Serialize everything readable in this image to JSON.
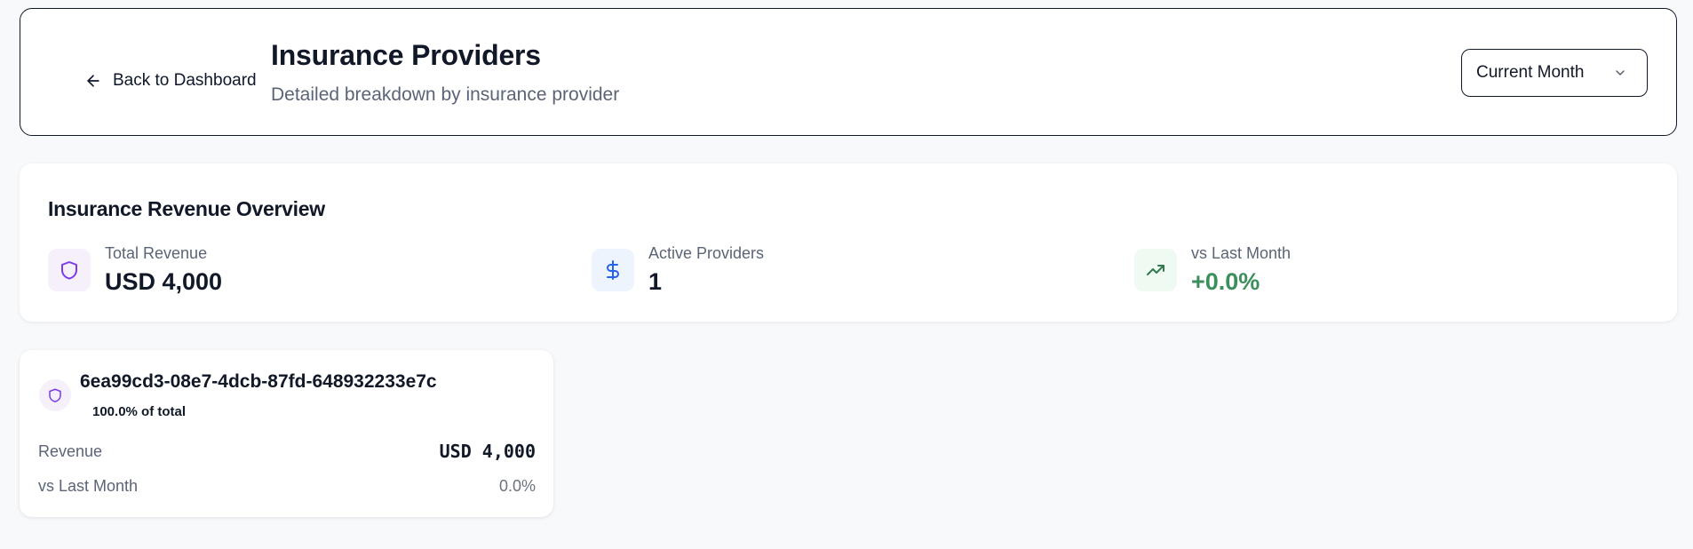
{
  "header": {
    "back_label": "Back to Dashboard",
    "title": "Insurance Providers",
    "subtitle": "Detailed breakdown by insurance provider",
    "period_select": {
      "selected": "Current Month"
    }
  },
  "overview": {
    "title": "Insurance Revenue Overview",
    "stats": [
      {
        "label": "Total Revenue",
        "value": "USD 4,000",
        "icon": "shield-icon",
        "icon_color": "#7c3aed",
        "icon_bg": "#f6f0fb"
      },
      {
        "label": "Active Providers",
        "value": "1",
        "icon": "dollar-icon",
        "icon_color": "#2563eb",
        "icon_bg": "#eef4fd"
      },
      {
        "label": "vs Last Month",
        "value": "+0.0%",
        "icon": "trending-up-icon",
        "icon_color": "#2f7a4e",
        "icon_bg": "#eefaf2",
        "value_color": "#3b8f5a"
      }
    ]
  },
  "providers": [
    {
      "name": "6ea99cd3-08e7-4dcb-87fd-648932233e7c",
      "share": "100.0% of total",
      "revenue_label": "Revenue",
      "revenue_value": "USD 4,000",
      "change_label": "vs Last Month",
      "change_value": "0.0%"
    }
  ]
}
